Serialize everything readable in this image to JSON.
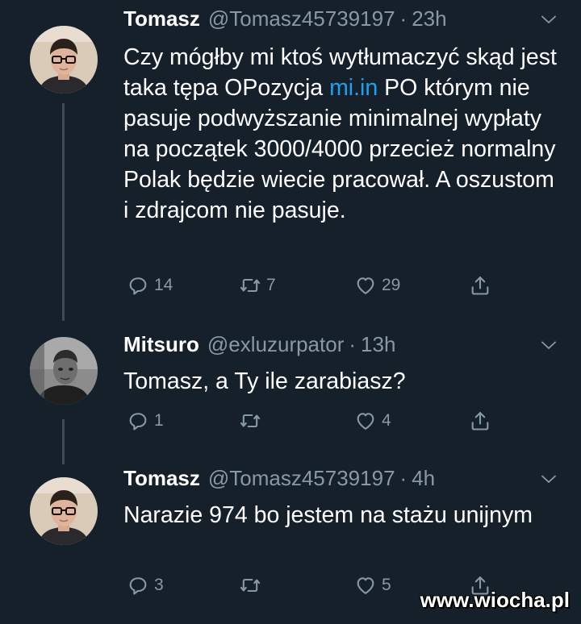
{
  "tweets": [
    {
      "name": "Tomasz",
      "handle": "@Tomasz45739197",
      "separator": "·",
      "time": "23h",
      "avatar": "young-man-glasses-avatar",
      "body_before": "Czy mógłby mi ktoś wytłumaczyć skąd jest taka tępa OPozycja ",
      "link": "mi.in",
      "body_after": " PO którym nie pasuje podwyższanie minimalnej wypłaty na początek 3000/4000 przecież normalny Polak będzie wiecie pracował. A oszustom i zdrajcom nie pasuje.",
      "replies": "14",
      "retweets": "7",
      "likes": "29"
    },
    {
      "name": "Mitsuro",
      "handle": "@exluzurpator",
      "separator": "·",
      "time": "13h",
      "avatar": "grayscale-man-avatar",
      "body": "Tomasz, a Ty ile zarabiasz?",
      "replies": "1",
      "retweets": "",
      "likes": "4"
    },
    {
      "name": "Tomasz",
      "handle": "@Tomasz45739197",
      "separator": "·",
      "time": "4h",
      "avatar": "young-man-glasses-avatar",
      "body": "Narazie 974 bo jestem na stażu unijnym",
      "replies": "3",
      "retweets": "",
      "likes": "5"
    }
  ],
  "watermark": "www.wiocha.pl",
  "colors": {
    "background": "#15202b",
    "secondary_text": "#8899a6",
    "link": "#1da1f2",
    "thread_line": "#3d4b58"
  }
}
